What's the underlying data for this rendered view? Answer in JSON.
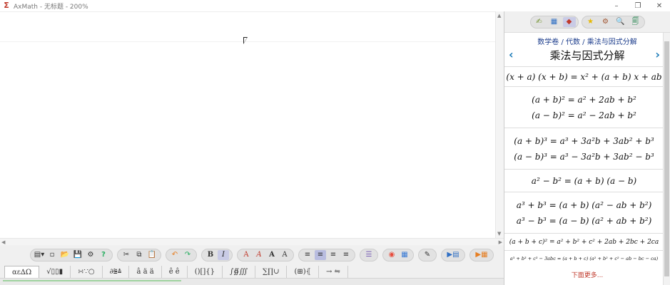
{
  "window": {
    "title": "AxMath - 无标题 - 200%",
    "minimize": "–",
    "restore": "❐",
    "close": "✕"
  },
  "toolbar": {
    "groups": [
      [
        "▤▾",
        "▫",
        "📂",
        "💾",
        "⚙",
        "?"
      ],
      [
        "✂",
        "⧉",
        "📋"
      ],
      [
        "↶",
        "↷"
      ],
      [
        "B",
        "I"
      ],
      [
        "A",
        "A",
        "A",
        "A"
      ],
      [
        "≡",
        "≡",
        "≡",
        "≡"
      ],
      [
        "☰"
      ],
      [
        "◉",
        "▦"
      ],
      [
        "✎"
      ],
      [
        "▶▤"
      ],
      [
        "▶▦"
      ]
    ]
  },
  "symbol_tabs": [
    "αε∆Ω",
    "√▯▯▮",
    "∺∵○",
    "∂⩰≗",
    "â ä ä",
    "ê ê",
    "()[]{}",
    "∫∯∭",
    "∑∏∪",
    "(⊞)⦃",
    "→ ⇋"
  ],
  "panel": {
    "tools": [
      [
        "✍",
        "▦",
        "◆"
      ],
      [
        "★",
        "⚙",
        "🔍",
        "🗐"
      ]
    ],
    "breadcrumb": "数学卷 / 代数 / 乘法与因式分解",
    "title": "乘法与因式分解",
    "prev": "‹",
    "next": "›",
    "formulas": [
      [
        "(x + a) (x + b) = x² + (a + b) x + ab"
      ],
      [
        "(a + b)² = a² + 2ab + b²",
        "(a − b)² = a² − 2ab + b²"
      ],
      [
        "(a + b)³ = a³ + 3a²b + 3ab² + b³",
        "(a − b)³ = a³ − 3a²b + 3ab² − b³"
      ],
      [
        "a² − b² = (a + b) (a − b)"
      ],
      [
        "a³ + b³ = (a + b) (a² − ab + b²)",
        "a³ − b³ = (a − b) (a² + ab + b²)"
      ],
      [
        "(a + b + c)² = a² + b² + c² + 2ab + 2bc + 2ca"
      ],
      [
        "a³ + b³ + c³ − 3abc = (a + b + c) (a² + b² + c² − ab − bc − ca)"
      ]
    ],
    "footer": "下面更多..."
  }
}
